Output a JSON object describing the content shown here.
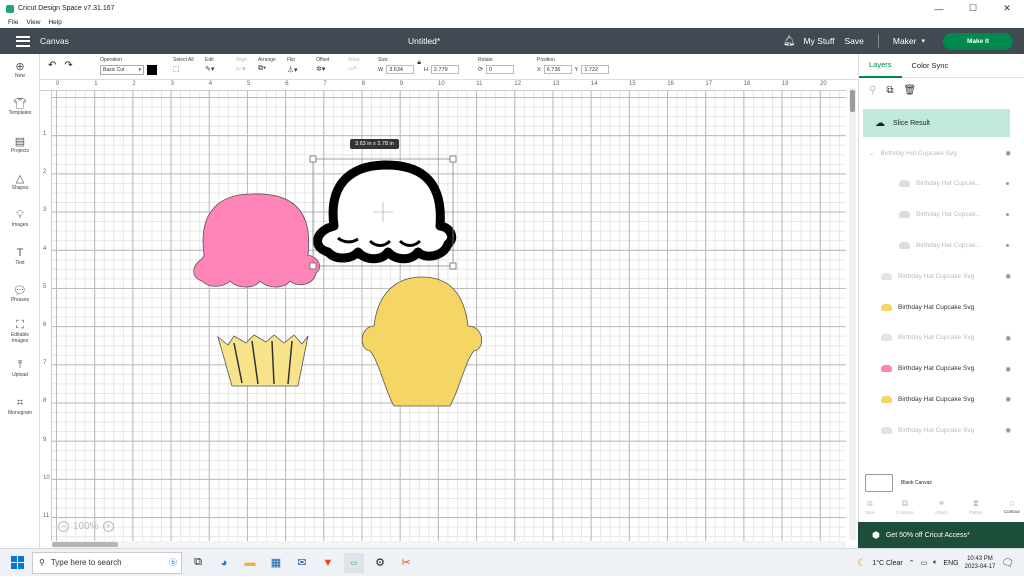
{
  "window": {
    "title": "Cricut Design Space  v7.31.167",
    "minimize": "—",
    "maximize": "☐",
    "close": "✕"
  },
  "menu": [
    "File",
    "View",
    "Help"
  ],
  "header": {
    "section": "Canvas",
    "doc_title": "Untitled*",
    "my_stuff": "My Stuff",
    "save": "Save",
    "machine": "Maker",
    "make_it": "Make It"
  },
  "toolbar": {
    "operation_label": "Operation",
    "operation_value": "Basic Cut",
    "select_all": "Select All",
    "edit": "Edit",
    "align": "Align",
    "arrange": "Arrange",
    "flip": "Flip",
    "offset": "Offset",
    "warp": "Warp",
    "size": "Size",
    "w_label": "W",
    "w_value": "3.634",
    "h_label": "H",
    "h_value": "2.779",
    "rotate": "Rotate",
    "rotate_value": "0",
    "position": "Position",
    "x_label": "X",
    "x_value": "6.736",
    "y_label": "Y",
    "y_value": "1.722"
  },
  "sidebar": [
    {
      "label": "New",
      "icon": "plus-icon"
    },
    {
      "label": "Templates",
      "icon": "shirt-icon"
    },
    {
      "label": "Projects",
      "icon": "projects-icon"
    },
    {
      "label": "Shapes",
      "icon": "shapes-icon"
    },
    {
      "label": "Images",
      "icon": "bulb-icon"
    },
    {
      "label": "Text",
      "icon": "text-icon"
    },
    {
      "label": "Phrases",
      "icon": "speech-icon"
    },
    {
      "label": "Editable Images",
      "icon": "editable-icon"
    },
    {
      "label": "Upload",
      "icon": "upload-icon"
    },
    {
      "label": "Monogram",
      "icon": "monogram-icon"
    }
  ],
  "ruler": {
    "top": [
      "0",
      "1",
      "2",
      "3",
      "4",
      "5",
      "6",
      "7",
      "8",
      "9",
      "10",
      "11",
      "12",
      "13",
      "14",
      "15",
      "16",
      "17",
      "18",
      "19",
      "20"
    ],
    "left": [
      "1",
      "2",
      "3",
      "4",
      "5",
      "6",
      "7",
      "8",
      "9",
      "10",
      "11"
    ]
  },
  "canvas": {
    "size_tooltip": "3.63  in x 2.78  in",
    "zoom": "100%",
    "colors": {
      "pink": "#ff84b7",
      "yellow": "#f5d564",
      "liner": "#f7e38a",
      "black": "#000000"
    }
  },
  "panel": {
    "tabs": [
      "Layers",
      "Color Sync"
    ],
    "slice_result": "Slice Result",
    "layers": [
      {
        "name": "Birthday Hat Cupcake Svg",
        "faded": true,
        "indent": 0,
        "swatch": "none",
        "marker": "eye"
      },
      {
        "name": "Birthday Hat Cupcak...",
        "faded": true,
        "indent": 1,
        "swatch": "#dddddd",
        "marker": "dot"
      },
      {
        "name": "Birthday Hat Cupcak...",
        "faded": true,
        "indent": 1,
        "swatch": "#dddddd",
        "marker": "dot"
      },
      {
        "name": "Birthday Hat Cupcak...",
        "faded": true,
        "indent": 1,
        "swatch": "#dddddd",
        "marker": "dot"
      },
      {
        "name": "Birthday Hat Cupcake Svg",
        "faded": true,
        "indent": 0,
        "swatch": "#e3e3e3",
        "marker": "eye"
      },
      {
        "name": "Birthday Hat Cupcake Svg",
        "faded": false,
        "indent": 0,
        "swatch": "#f5d564",
        "marker": "none"
      },
      {
        "name": "Birthday Hat Cupcake Svg",
        "faded": true,
        "indent": 0,
        "swatch": "#e3e3e3",
        "marker": "eye"
      },
      {
        "name": "Birthday Hat Cupcake Svg",
        "faded": false,
        "indent": 0,
        "swatch": "#ff84b7",
        "marker": "eye"
      },
      {
        "name": "Birthday Hat Cupcake Svg",
        "faded": false,
        "indent": 0,
        "swatch": "#f5d564",
        "marker": "eye"
      },
      {
        "name": "Birthday Hat Cupcake Svg",
        "faded": true,
        "indent": 0,
        "swatch": "#e3e3e3",
        "marker": "eye"
      }
    ],
    "blank_canvas": "Blank Canvas",
    "bottom_tools": [
      "Slice",
      "Combine",
      "Attach",
      "Flatten",
      "Contour"
    ],
    "promo": "Get 50% off Cricut Access*"
  },
  "taskbar": {
    "search_placeholder": "Type here to search",
    "weather": "1°C  Clear",
    "lang": "ENG",
    "time": "10:43 PM",
    "date": "2023-04-17"
  }
}
